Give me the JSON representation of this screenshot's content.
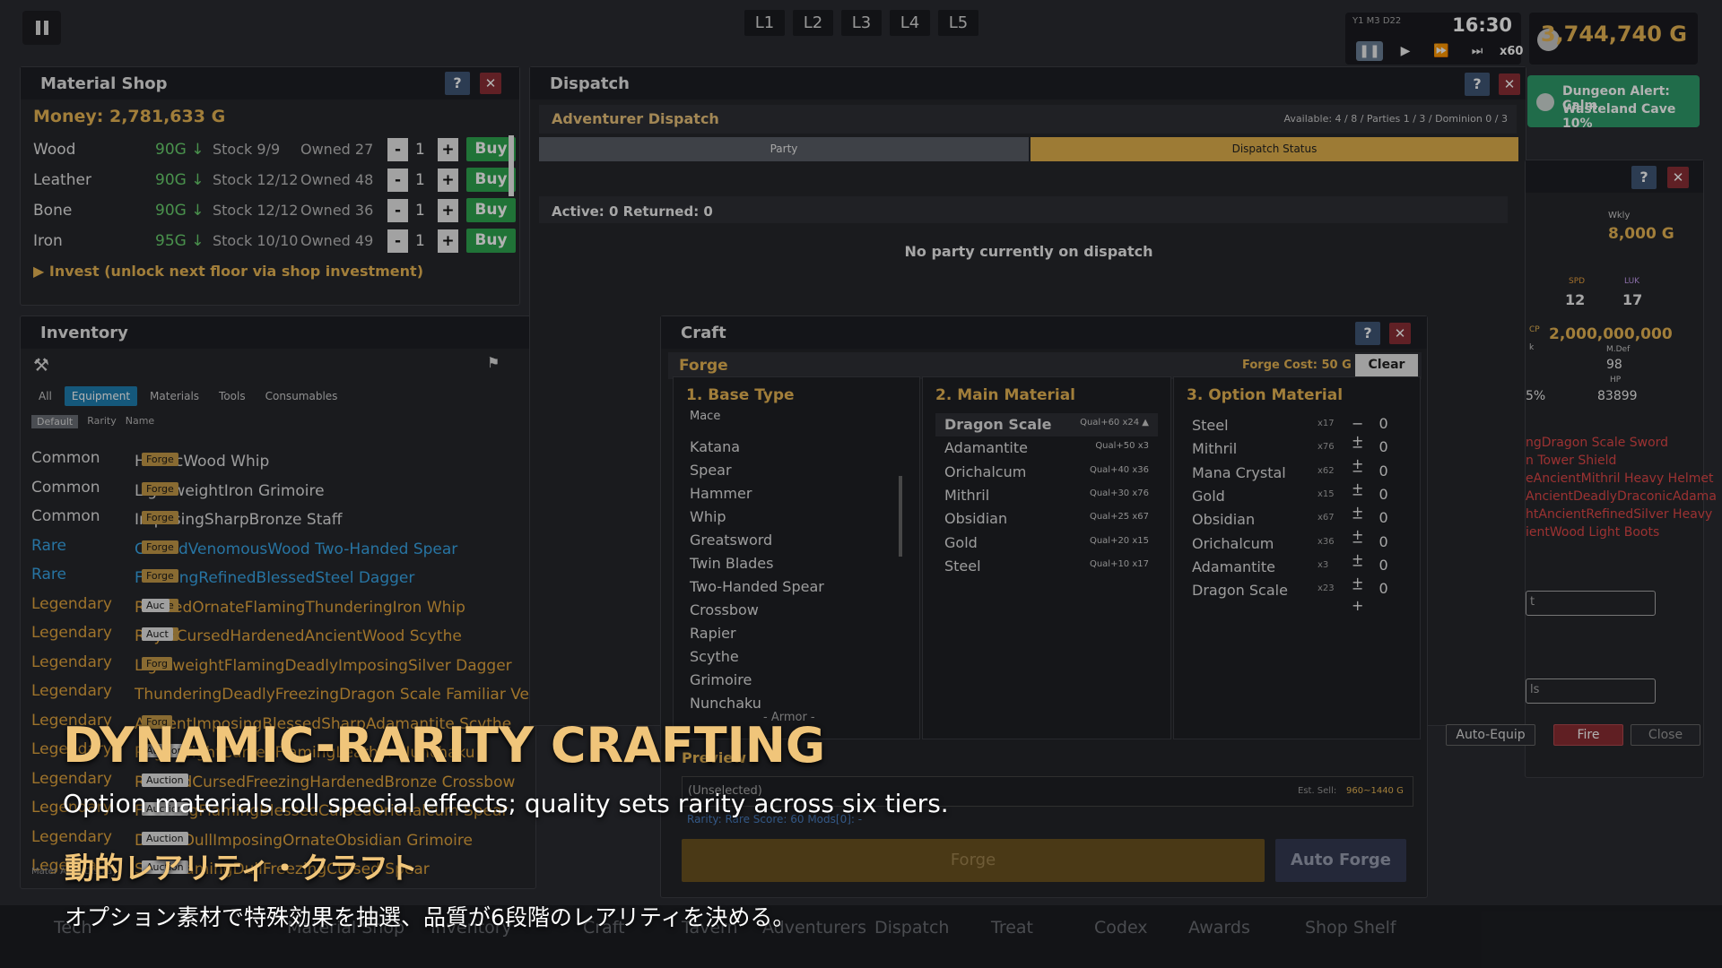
{
  "floors": [
    "L1",
    "L2",
    "L3",
    "L4",
    "L5"
  ],
  "clock": {
    "date": "Y1 M3 D22",
    "time": "16:30",
    "speed": "x60"
  },
  "gold": "3,744,740 G",
  "alert": {
    "line1": "Dungeon Alert: Calm",
    "line2": "Wasteland Cave  10%"
  },
  "shop": {
    "title": "Material Shop",
    "help": "?",
    "close": "✕",
    "money": "Money: 2,781,633 G",
    "rows": [
      {
        "name": "Wood",
        "price": "90G ↓",
        "stock": "Stock 9/9",
        "owned": "Owned 27",
        "qty": "1",
        "buy": "Buy"
      },
      {
        "name": "Leather",
        "price": "90G ↓",
        "stock": "Stock 12/12",
        "owned": "Owned 48",
        "qty": "1",
        "buy": "Buy"
      },
      {
        "name": "Bone",
        "price": "90G ↓",
        "stock": "Stock 12/12",
        "owned": "Owned 36",
        "qty": "1",
        "buy": "Buy"
      },
      {
        "name": "Iron",
        "price": "95G ↓",
        "stock": "Stock 10/10",
        "owned": "Owned 49",
        "qty": "1",
        "buy": "Buy"
      }
    ],
    "minus": "-",
    "plus": "+",
    "invest": "▶ Invest (unlock next floor via shop investment)"
  },
  "inventory": {
    "title": "Inventory",
    "tabs": [
      "All",
      "Equipment",
      "Materials",
      "Tools",
      "Consumables"
    ],
    "sorts": [
      "Default",
      "Rarity",
      "Name"
    ],
    "rows": [
      {
        "rarity": "Common",
        "name": "HeroicWood Whip",
        "tags": [
          "Forge"
        ],
        "cls": "common"
      },
      {
        "rarity": "Common",
        "name": "LightweightIron Grimoire",
        "tags": [
          "Forge"
        ],
        "cls": "common"
      },
      {
        "rarity": "Common",
        "name": "ImposingSharpBronze Staff",
        "tags": [
          "Forge"
        ],
        "cls": "common"
      },
      {
        "rarity": "Rare",
        "name": "CursedVenomousWood Two-Handed Spear",
        "tags": [
          "Forge"
        ],
        "cls": "rare"
      },
      {
        "rarity": "Rare",
        "name": "FreezingRefinedBlessedSteel Dagger",
        "tags": [
          "Forge"
        ],
        "cls": "rare"
      },
      {
        "rarity": "Legendary",
        "name": "RefinedOrnateFlamingThunderingIron Whip",
        "tags": [
          "Forge",
          "Auc"
        ],
        "cls": "leg"
      },
      {
        "rarity": "Legendary",
        "name": "RoyalCursedHardenedAncientWood Scythe",
        "tags": [
          "Forge",
          "Auct"
        ],
        "cls": "leg"
      },
      {
        "rarity": "Legendary",
        "name": "LightweightFlamingDeadlyImposingSilver Dagger",
        "tags": [
          "Forg"
        ],
        "cls": "leg"
      },
      {
        "rarity": "Legendary",
        "name": "ThunderingDeadlyFreezingDragon Scale Familiar Vesse",
        "tags": [],
        "cls": "leg"
      },
      {
        "rarity": "Legendary",
        "name": "AncientImposingBlessedSharpAdamantite Scythe",
        "tags": [
          "Forg"
        ],
        "cls": "leg"
      },
      {
        "rarity": "Legendary",
        "name": "RegalWightCursedFlamingLeather Nunchaku",
        "tags": [
          "Forge",
          "Auction"
        ],
        "cls": "leg"
      },
      {
        "rarity": "Legendary",
        "name": "RefinedCursedFreezingHardenedBronze Crossbow",
        "tags": [
          "Forge",
          "Auction"
        ],
        "cls": "leg"
      },
      {
        "rarity": "Legendary",
        "name": "FreezingFlamingBlessedCursedOrichalcum Spear",
        "tags": [
          "Forge",
          "Auction"
        ],
        "cls": "leg"
      },
      {
        "rarity": "Legendary",
        "name": "DivineDullImposingOrnateObsidian Grimoire",
        "tags": [
          "Forge",
          "Auction"
        ],
        "cls": "leg"
      },
      {
        "rarity": "Legendary",
        "name": "SwiftFlamingDullFreezingCursed Spear",
        "tags": [
          "Forge",
          "Auction"
        ],
        "cls": "leg"
      }
    ],
    "footer": "Mater  Auto-Display"
  },
  "dispatch": {
    "title": "Dispatch",
    "header": "Adventurer Dispatch",
    "status": "Available: 4 / 8  /  Parties 1 / 3  /  Dominion 0 / 3",
    "tab_party": "Party",
    "tab_status": "Dispatch Status",
    "counts": "Active: 0   Returned: 0",
    "empty": "No party currently on dispatch"
  },
  "hero": {
    "wkly_label": "Wkly",
    "wkly": "8,000 G",
    "spd_label": "SPD",
    "spd": "12",
    "luk_label": "LUK",
    "luk": "17",
    "cp_label": "CP",
    "cp": "2,000,000,000",
    "k_label": "k",
    "mdef_label": "M.Def",
    "mdef": "98",
    "hp_label": "HP",
    "hp": "83899",
    "pct": "5%",
    "equip": [
      "ngDragon Scale Sword",
      "n Tower Shield",
      "eAncientMithril Heavy Helmet",
      "AncientDeadlyDraconicAdama",
      "htAncientRefinedSilver Heavy",
      "ientWood Light Boots"
    ],
    "btn1": "t",
    "btn2": "ls",
    "auto_equip": "Auto-Equip",
    "fire": "Fire",
    "close": "Close"
  },
  "craft": {
    "title": "Craft",
    "forge": "Forge",
    "cost": "Forge Cost: 50 G",
    "clear": "Clear",
    "col1": "1. Base Type",
    "col2": "2. Main Material",
    "col3": "3. Option Material",
    "base": [
      "Mace",
      "Katana",
      "Spear",
      "Hammer",
      "Whip",
      "Greatsword",
      "Twin Blades",
      "Two-Handed Spear",
      "Crossbow",
      "Rapier",
      "Scythe",
      "Grimoire",
      "Nunchaku"
    ],
    "armor": "- Armor -",
    "main": [
      {
        "name": "Dragon Scale",
        "q": "Qual+60  x24 ▲"
      },
      {
        "name": "Adamantite",
        "q": "Qual+50 x3"
      },
      {
        "name": "Orichalcum",
        "q": "Qual+40 x36"
      },
      {
        "name": "Mithril",
        "q": "Qual+30 x76"
      },
      {
        "name": "Obsidian",
        "q": "Qual+25 x67"
      },
      {
        "name": "Gold",
        "q": "Qual+20 x15"
      },
      {
        "name": "Steel",
        "q": "Qual+10 x17"
      }
    ],
    "options": [
      {
        "name": "Steel",
        "x": "x17"
      },
      {
        "name": "Mithril",
        "x": "x76"
      },
      {
        "name": "Mana Crystal",
        "x": "x62"
      },
      {
        "name": "Gold",
        "x": "x15"
      },
      {
        "name": "Obsidian",
        "x": "x67"
      },
      {
        "name": "Orichalcum",
        "x": "x36"
      },
      {
        "name": "Adamantite",
        "x": "x3"
      },
      {
        "name": "Dragon Scale",
        "x": "x23"
      }
    ],
    "opt_ctl": "− 0 +",
    "preview": "Preview",
    "unselected": "(Unselected)",
    "est": "Est. Sell:",
    "est_val": "960~1440 G",
    "rarity": "Rarity: Rare Score: 60 Mods[0]: -",
    "forge_btn": "Forge",
    "auto_forge": "Auto Forge"
  },
  "nav": [
    "Tech",
    "Material Shop",
    "Inventory",
    "Craft",
    "Tavern",
    "Adventurers",
    "Dispatch",
    "Treat",
    "Codex",
    "Awards",
    "Shop Shelf"
  ],
  "overlay": {
    "title": "DYNAMIC-RARITY CRAFTING",
    "subtitle": "Option materials roll special effects; quality sets rarity across six tiers.",
    "jp_title": "動的レアリティ・クラフト",
    "jp_sub": "オプション素材で特殊効果を抽選、品質が6段階のレアリティを決める。"
  }
}
